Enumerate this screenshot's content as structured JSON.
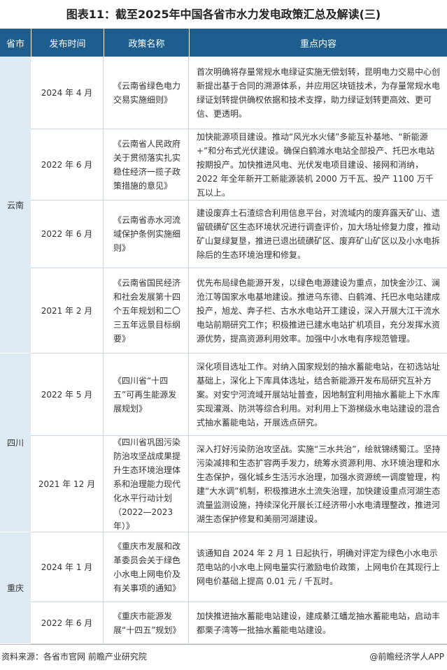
{
  "title": "图表11：截至2025年中国各省市水力发电政策汇总及解读(三)",
  "headers": {
    "province": "省市",
    "date": "发布时间",
    "name": "政策名称",
    "content": "重点内容"
  },
  "provinces": [
    "云南",
    "四川",
    "重庆"
  ],
  "rows": [
    {
      "date": "2024 年 4 月",
      "name": "《云南省绿色电力交易实施细则》",
      "content": "首次明确将存量常规水电绿证实施无偿划转，昆明电力交易中心创新提出基于合同的溯源体系，并应用区块链技术，为存量常规水电绿证划转提供确权依据和技术支撑，助力绿证划转更高效、更可信、更透明。"
    },
    {
      "date": "2022 年 6 月",
      "name": "《云南省人民政府关于贯彻落实扎实稳住经济一揽子政策措施的意见》",
      "content": "加快能源项目建设。推动“风光水火储”多能互补基地、“新能源+”和分布式光伏建设。确保白鹤滩水电站全部投产、托巴水电站按期投产。加快推进风电、光伏发电项目建设、接网和消纳，2022 年全年新开工新能源装机 2000 万千瓦、投产 1100 万千瓦以上。"
    },
    {
      "date": "2022 年 6 月",
      "name": "《云南省赤水河流域保护条例实施细则》",
      "content": "建设废弃土石渣综合利用信息平台，对流域内的废弃露天矿山、遗留硫磺矿区生态环境状况进行调查评价，加大场址修复力度，推动矿山复绿复垦，推进已退出硫磺矿区、废弃矿山矿区以及小水电拆除后的生态环境治理和修复。"
    },
    {
      "date": "2021 年 2 月",
      "name": "《云南省国民经济和社会发展第十四个五年规划和二〇三五年远景目标纲要》",
      "content": "优先布局绿色能源开发，以绿色电源建设为重点，加快金沙江、澜沧江等国家水电基地建设。推进乌东德、白鹤滩、托巴水电站建成投产，旭龙、奔子栏、古水水电站开工建设，深入开展大江干流水电站前期研究工作；积极推进已建水电站扩机项目，充分发挥水资源优势，提高资源利用效率。加强中小水电有序规范管理。"
    },
    {
      "date": "2022 年 5 月",
      "name": "《四川省“十四五”可再生能源发展规划》",
      "content": "深化项目选址工作。对纳入国家规划的抽水蓄能电站，在初选站址基础上，深化上下库具体选址，结合新能源开发布局研究互补方案。对安宁河流域开展站址普查，因地制宜利用抽水蓄能上下水库实现灌溉、防洪等综合利用。对利用上下游梯级水电站建设的混合式抽水蓄能电站，开展选点研究。"
    },
    {
      "date": "2021 年 12 月",
      "name": "《四川省巩固污染防治攻坚战成果提升生态环境治理体系和治理能力现代化水平行动计划（2022—2023年）》",
      "content": "深入打好污染防治攻坚战。实施“三水共治”，绘就锦绣蜀江。坚持污染减排和生态扩容两手发力，统筹水资源利用、水环境治理和水生态保护，强化城乡生活污水治理，加强水资源统一调度管理，构建“大水调”机制，积极推进水土流失治理，加快建设重点河湖生态流量监测设施，持续深化开展长江经济带小水电清理整改，推进河湖生态保护修复和美丽河湖建设。"
    },
    {
      "date": "2024 年 1 月",
      "name": "《重庆市发展和改革委员会关于绿色小水电上网电价及有关事项的通知》",
      "content": "该通知自 2024 年 2 月 1 日起执行，明确对评定为绿色小水电示范电站的小水电上网电量实行激励电价政策，上网电价在其现行上网电价基础上提高 0.01 元 / 千瓦时。"
    },
    {
      "date": "2022 年 6 月",
      "name": "《重庆市能源发展“十四五”规划》",
      "content": "加快推进抽水蓄能电站建设，建成綦江蟠龙抽水蓄能电站，启动丰都栗子湾等一批抽水蓄能电站建设。"
    }
  ],
  "footer": {
    "source": "资料来源：各省市官网 前瞻产业研究院",
    "brand": "@前瞻经济学人APP"
  }
}
